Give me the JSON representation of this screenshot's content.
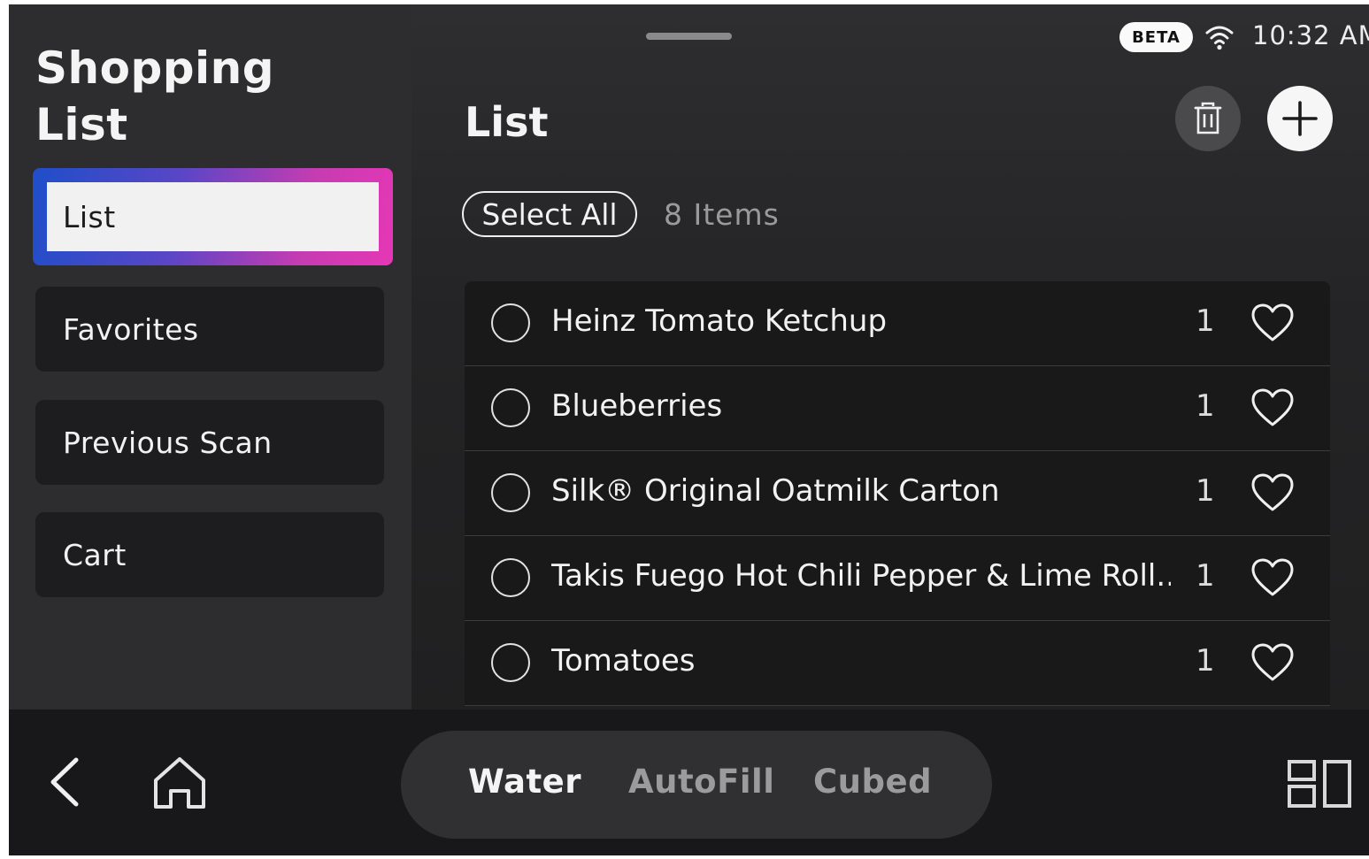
{
  "sidebar": {
    "title_line1": "Shopping",
    "title_line2": "List",
    "items": [
      {
        "label": "List",
        "active": true
      },
      {
        "label": "Favorites"
      },
      {
        "label": "Previous Scan"
      },
      {
        "label": "Cart"
      }
    ]
  },
  "status": {
    "beta": "BETA",
    "wifi_icon": "wifi-icon",
    "time": "10:32 AM"
  },
  "main": {
    "title": "List",
    "delete_icon": "trash-icon",
    "add_icon": "plus-icon",
    "select_all": "Select All",
    "count": "8 Items",
    "items": [
      {
        "name": "Heinz Tomato Ketchup",
        "qty": "1"
      },
      {
        "name": "Blueberries",
        "qty": "1"
      },
      {
        "name": "Silk® Original Oatmilk Carton",
        "qty": "1"
      },
      {
        "name": "Takis Fuego Hot Chili Pepper & Lime Roll...",
        "qty": "1"
      },
      {
        "name": "Tomatoes",
        "qty": "1"
      }
    ]
  },
  "bottom": {
    "back_icon": "back-chevron-icon",
    "home_icon": "home-icon",
    "modes": [
      {
        "label": "Water",
        "active": true
      },
      {
        "label": "AutoFill"
      },
      {
        "label": "Cubed"
      }
    ],
    "apps_icon": "apps-grid-icon"
  },
  "colors": {
    "accent_gradient_start": "#1f4ec9",
    "accent_gradient_end": "#e637b5",
    "background": "#222222"
  }
}
